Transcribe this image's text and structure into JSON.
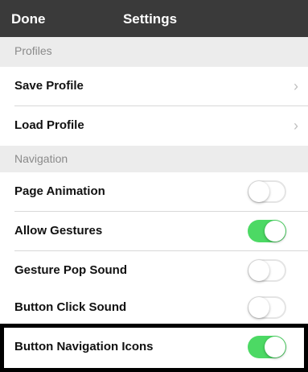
{
  "navbar": {
    "done_label": "Done",
    "title": "Settings"
  },
  "sections": {
    "profiles": {
      "header": "Profiles"
    },
    "navigation": {
      "header": "Navigation"
    }
  },
  "rows": {
    "save_profile": "Save Profile",
    "load_profile": "Load Profile",
    "page_animation": {
      "label": "Page Animation",
      "on": false
    },
    "allow_gestures": {
      "label": "Allow Gestures",
      "on": true
    },
    "gesture_pop_sound": {
      "label": "Gesture Pop Sound",
      "on": false
    },
    "button_click_sound": {
      "label": "Button Click Sound",
      "on": false
    },
    "button_navigation_icons": {
      "label": "Button Navigation Icons",
      "on": true
    }
  },
  "icons": {
    "disclosure": "chevron-right-icon"
  },
  "colors": {
    "toggle_on": "#4cd964",
    "navbar": "#3a3a3a"
  }
}
